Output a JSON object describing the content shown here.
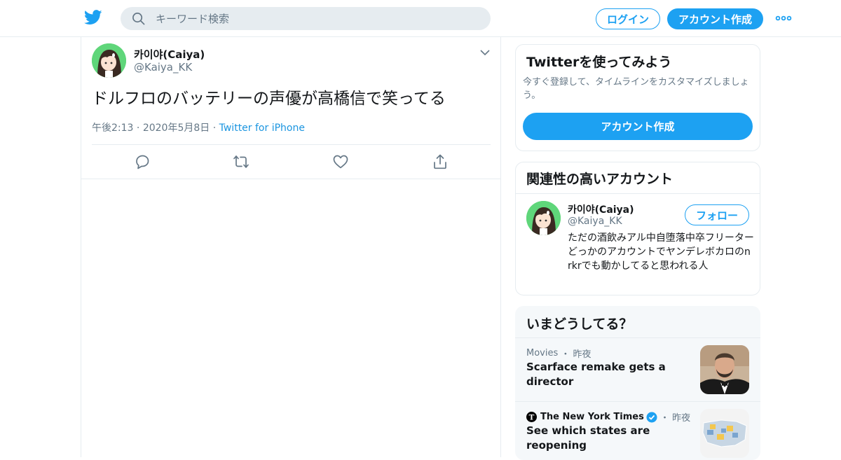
{
  "colors": {
    "accent": "#1da1f2",
    "link": "#1b95e0",
    "text": "#14171a",
    "muted": "#657786",
    "border": "#e6ecf0",
    "avatar_bg": "#5fd67a"
  },
  "topbar": {
    "logo_icon": "twitter-bird-icon",
    "search_icon": "search-icon",
    "search_placeholder": "キーワード検索",
    "login_label": "ログイン",
    "signup_label": "アカウント作成",
    "more_icon": "more-dots-icon"
  },
  "tweet": {
    "author_name": "카이야(Caiya)",
    "author_handle": "@Kaiya_KK",
    "text": "ドルフロのバッテリーの声優が高橋信で笑ってる",
    "time": "午後2:13",
    "date": "2020年5月8日",
    "source": "Twitter for iPhone",
    "actions": [
      {
        "icon": "reply-icon"
      },
      {
        "icon": "retweet-icon"
      },
      {
        "icon": "like-icon"
      },
      {
        "icon": "share-icon"
      }
    ]
  },
  "signup_card": {
    "title": "Twitterを使ってみよう",
    "description": "今すぐ登録して、タイムラインをカスタマイズしましょう。",
    "button_label": "アカウント作成"
  },
  "related_card": {
    "title": "関連性の高いアカウント",
    "account": {
      "name": "카이야(Caiya)",
      "handle": "@Kaiya_KK",
      "follow_label": "フォロー",
      "bio": "ただの酒飲みアル中自堕落中卒フリーター どっかのアカウントでヤンデレボカロのnrkrでも動かしてると思われる人"
    }
  },
  "trends_card": {
    "title": "いまどうしてる？",
    "items": [
      {
        "category": "Movies",
        "time": "昨夜",
        "headline": "Scarface remake gets a director"
      },
      {
        "source": "The New York Times",
        "verified": true,
        "time": "昨夜",
        "headline": "See which states are reopening"
      }
    ]
  }
}
